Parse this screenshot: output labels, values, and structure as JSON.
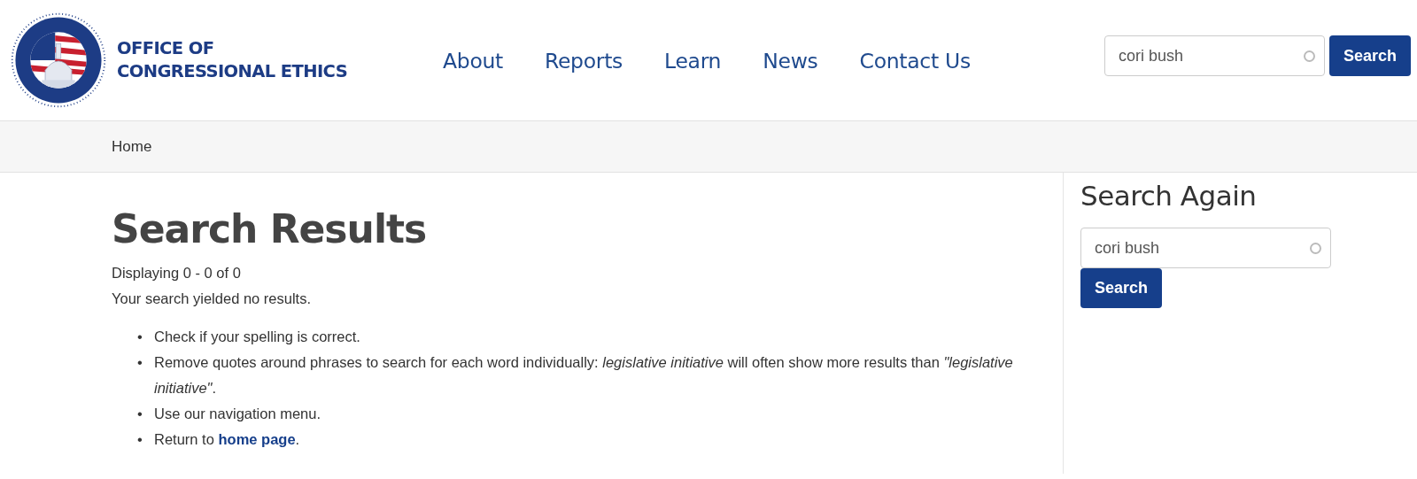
{
  "logo": {
    "title_lines": [
      "OFFICE OF",
      "CONGRESSIONAL ETHICS"
    ]
  },
  "nav": [
    "About",
    "Reports",
    "Learn",
    "News",
    "Contact Us"
  ],
  "header_search": {
    "value": "cori bush",
    "button": "Search"
  },
  "breadcrumb": [
    "Home"
  ],
  "main": {
    "heading": "Search Results",
    "count": "Displaying 0 - 0 of 0",
    "message": "Your search yielded no results.",
    "tips": [
      {
        "marker": "•",
        "text": "Check if your spelling is correct."
      },
      {
        "marker": "•",
        "text": "Remove quotes around phrases to search for each word individually: *legislative initiative* will often show more results than *\"legislative initiative\"*."
      },
      {
        "marker": "•",
        "text": "Use our navigation menu."
      },
      {
        "marker": "•",
        "text": "Return to ",
        "link": "home page",
        "after": "."
      }
    ]
  },
  "sidebar": {
    "heading": "Search Again",
    "value": "cori bush",
    "button": "Search"
  }
}
